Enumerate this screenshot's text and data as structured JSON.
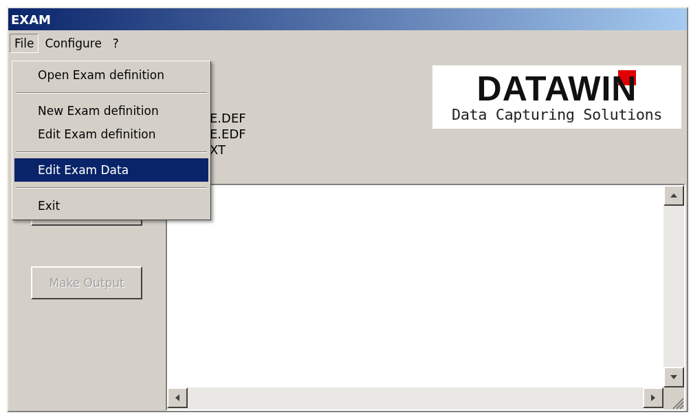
{
  "window": {
    "title": "EXAM"
  },
  "menu_bar": [
    {
      "label": "File",
      "selected": true
    },
    {
      "label": "Configure",
      "selected": false
    },
    {
      "label": "?",
      "selected": false
    }
  ],
  "file_menu": [
    {
      "kind": "item",
      "label": "Open Exam definition",
      "selected": false
    },
    {
      "kind": "separator"
    },
    {
      "kind": "item",
      "label": "New Exam definition",
      "selected": false
    },
    {
      "kind": "item",
      "label": "Edit Exam definition",
      "selected": false
    },
    {
      "kind": "separator"
    },
    {
      "kind": "item",
      "label": "Edit Exam Data",
      "selected": true
    },
    {
      "kind": "separator"
    },
    {
      "kind": "item",
      "label": "Exit",
      "selected": false
    }
  ],
  "file_labels": [
    "E.DEF",
    "E.EDF",
    "XT"
  ],
  "logo": {
    "name": "DATAWIN",
    "tagline": "Data Capturing Solutions"
  },
  "buttons": [
    {
      "label": "Make Output",
      "disabled": true
    }
  ]
}
